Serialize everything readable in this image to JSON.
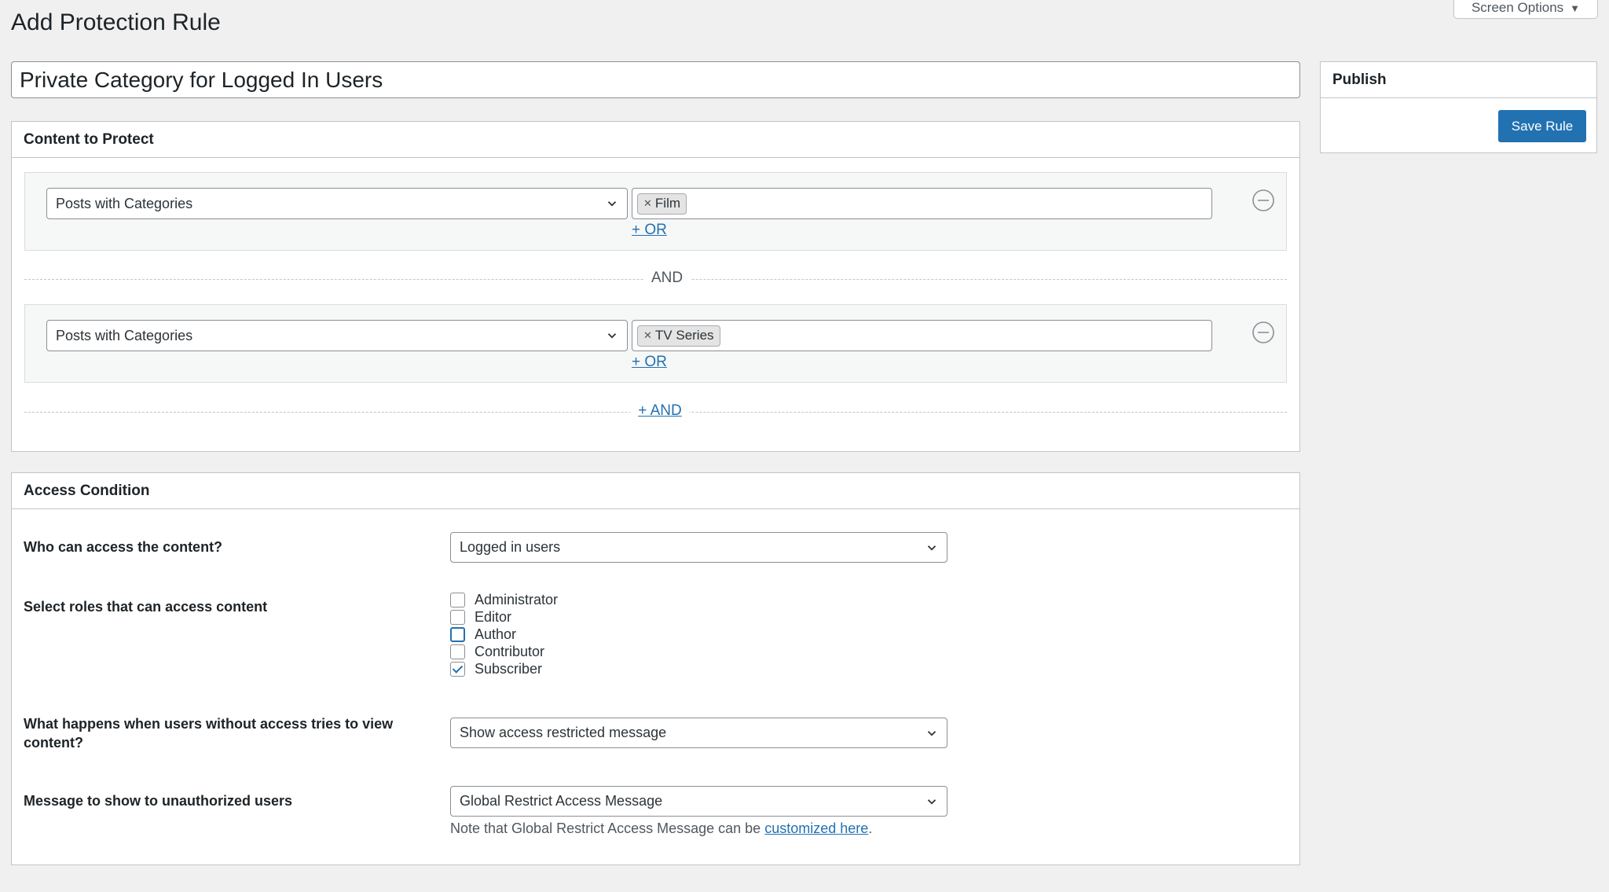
{
  "header": {
    "page_title": "Add Protection Rule",
    "screen_options": "Screen Options"
  },
  "rule_title": "Private Category for Logged In Users",
  "content_to_protect": {
    "heading": "Content to Protect",
    "groups": [
      {
        "type": "Posts with Categories",
        "tags": [
          "Film"
        ],
        "or_label": "+ OR"
      },
      {
        "type": "Posts with Categories",
        "tags": [
          "TV Series"
        ],
        "or_label": "+ OR"
      }
    ],
    "and_label": "AND",
    "add_and_label": "+ AND"
  },
  "access_condition": {
    "heading": "Access Condition",
    "who_label": "Who can access the content?",
    "who_value": "Logged in users",
    "roles_label": "Select roles that can access content",
    "roles": [
      {
        "name": "Administrator",
        "checked": false
      },
      {
        "name": "Editor",
        "checked": false
      },
      {
        "name": "Author",
        "checked": false,
        "focused": true
      },
      {
        "name": "Contributor",
        "checked": false
      },
      {
        "name": "Subscriber",
        "checked": true
      }
    ],
    "what_happens_label": "What happens when users without access tries to view content?",
    "what_happens_value": "Show access restricted message",
    "message_label": "Message to show to unauthorized users",
    "message_value": "Global Restrict Access Message",
    "note_prefix": "Note that Global Restrict Access Message can be ",
    "note_link": "customized here",
    "note_suffix": "."
  },
  "publish": {
    "heading": "Publish",
    "save_label": "Save Rule"
  },
  "colors": {
    "accent": "#2271b1",
    "background": "#f0f0f1"
  },
  "icons": {
    "select_chevron": "chevron-down-icon",
    "remove_group": "minus-circle-icon",
    "tag_remove": "close-icon",
    "screen_options_caret": "caret-down-icon"
  }
}
